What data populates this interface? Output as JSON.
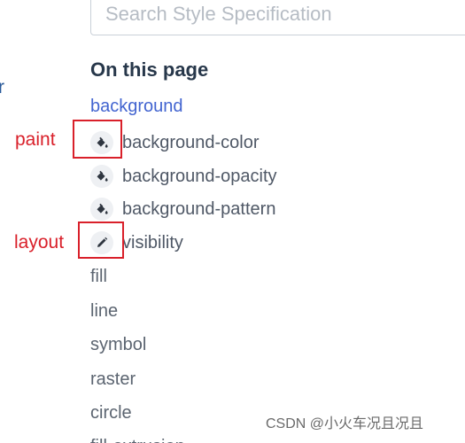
{
  "left_fragment": "r",
  "search": {
    "placeholder": "Search Style Specification",
    "value": ""
  },
  "toc": {
    "heading": "On this page",
    "section": "background",
    "items": [
      {
        "label": "background-color",
        "icon": "paint-bucket-icon",
        "type": "paint"
      },
      {
        "label": "background-opacity",
        "icon": "paint-bucket-icon",
        "type": "paint"
      },
      {
        "label": "background-pattern",
        "icon": "paint-bucket-icon",
        "type": "paint"
      },
      {
        "label": "visibility",
        "icon": "pencil-icon",
        "type": "layout"
      }
    ],
    "groups": [
      "fill",
      "line",
      "symbol",
      "raster",
      "circle",
      "fill-extrusion"
    ]
  },
  "annotations": {
    "paint": "paint",
    "layout": "layout",
    "color": "#d9202a"
  },
  "colors": {
    "link": "#4264d0",
    "heading": "#27374a",
    "text": "#4f5866",
    "icon_bg": "#eef0f3"
  },
  "watermark": "CSDN @小火车况且况且"
}
